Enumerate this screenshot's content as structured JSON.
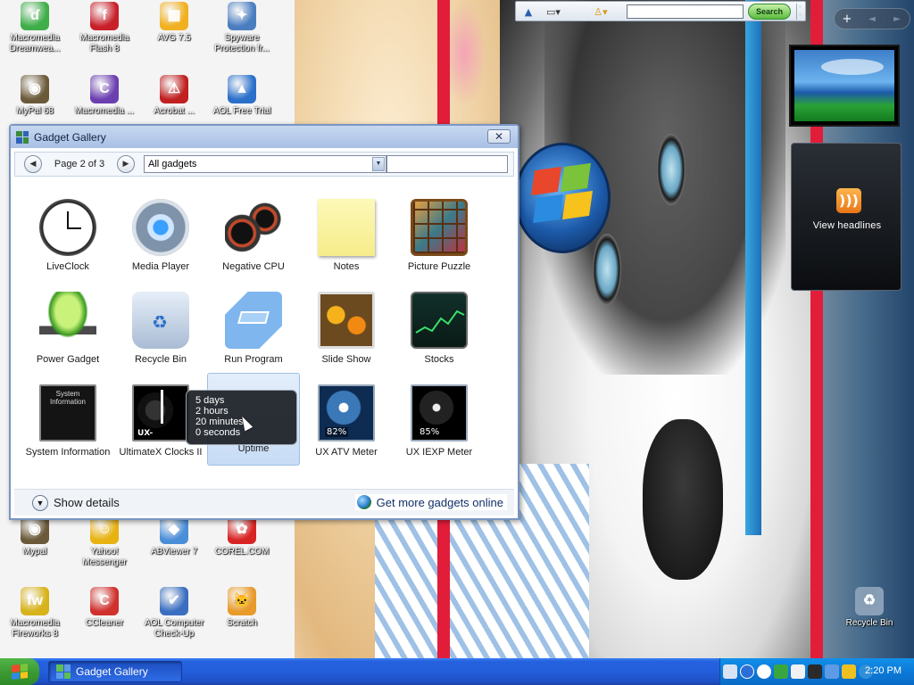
{
  "desktop_icons": [
    {
      "label": "Macromedia Dreamwea...",
      "icon": "dreamweaver-icon",
      "color": "#3fae49",
      "glyph": "ɗ"
    },
    {
      "label": "Macromedia Flash 8",
      "icon": "flash-icon",
      "color": "#c8202a",
      "glyph": "f"
    },
    {
      "label": "AVG 7.5",
      "icon": "avg-icon",
      "color": "#f0b020",
      "glyph": "▦"
    },
    {
      "label": "Spyware Protection fr...",
      "icon": "spyware-protection-icon",
      "color": "#4a7ec0",
      "glyph": "✦"
    },
    {
      "label": "MyPal 68",
      "icon": "mypal-icon",
      "color": "#6b5a3a",
      "glyph": "◉"
    },
    {
      "label": "Macromedia ...",
      "icon": "contribute-icon",
      "color": "#6b3fb0",
      "glyph": "C"
    },
    {
      "label": "Acrobat ...",
      "icon": "acrobat-icon",
      "color": "#c02020",
      "glyph": "⚠"
    },
    {
      "label": "AOL Free Trial",
      "icon": "aol-icon",
      "color": "#2a6fc9",
      "glyph": "▲"
    },
    {
      "label": "Mypal",
      "icon": "mypal2-icon",
      "color": "#6b5a3a",
      "glyph": "◉"
    },
    {
      "label": "Yahoo! Messenger",
      "icon": "yahoo-messenger-icon",
      "color": "#e8b210",
      "glyph": "☺"
    },
    {
      "label": "ABViewer 7",
      "icon": "abviewer-icon",
      "color": "#4a8ed8",
      "glyph": "◆"
    },
    {
      "label": "COREL.COM",
      "icon": "corel-icon",
      "color": "#d82424",
      "glyph": "✿"
    },
    {
      "label": "Macromedia Fireworks 8",
      "icon": "fireworks-icon",
      "color": "#d7b21a",
      "glyph": "fw"
    },
    {
      "label": "CCleaner",
      "icon": "ccleaner-icon",
      "color": "#d0312d",
      "glyph": "C"
    },
    {
      "label": "AOL Computer Check-Up",
      "icon": "aol-checkup-icon",
      "color": "#3a6ec0",
      "glyph": "✔"
    },
    {
      "label": "Scratch",
      "icon": "scratch-icon",
      "color": "#e89a2a",
      "glyph": "🐱"
    },
    {
      "label": "Recycle Bin",
      "icon": "recycle-bin-desktop-icon",
      "color": "#8aa0b8",
      "glyph": "♻"
    }
  ],
  "search_toolbar": {
    "search_placeholder": "",
    "search_button": "Search"
  },
  "sidebar": {
    "controls": {
      "add": "+",
      "prev": "◄",
      "next": "►"
    },
    "rss_label": "View headlines"
  },
  "gallery": {
    "title": "Gadget Gallery",
    "close_glyph": "✕",
    "page_indicator": "Page 2 of 3",
    "category": "All gadgets",
    "gadgets": [
      {
        "name": "LiveClock",
        "icon": "clock-icon"
      },
      {
        "name": "Media Player",
        "icon": "media-player-icon"
      },
      {
        "name": "Negative CPU",
        "icon": "cpu-meter-icon"
      },
      {
        "name": "Notes",
        "icon": "notes-icon"
      },
      {
        "name": "Picture Puzzle",
        "icon": "picture-puzzle-icon"
      },
      {
        "name": "Power Gadget",
        "icon": "battery-plug-icon"
      },
      {
        "name": "Recycle Bin",
        "icon": "recycle-bin-icon"
      },
      {
        "name": "Run Program",
        "icon": "run-program-icon"
      },
      {
        "name": "Slide Show",
        "icon": "slide-show-icon"
      },
      {
        "name": "Stocks",
        "icon": "stocks-icon"
      },
      {
        "name": "System Information",
        "icon": "system-information-icon",
        "inner_text": "System Information"
      },
      {
        "name": "UltimateX Clocks II",
        "icon": "ultimatex-clock-icon",
        "inner_text": "UX-"
      },
      {
        "name": "Uptime",
        "icon": "uptime-icon",
        "selected": true
      },
      {
        "name": "UX ATV Meter",
        "icon": "atv-meter-icon",
        "inner_text": "82%"
      },
      {
        "name": "UX IEXP Meter",
        "icon": "iexp-meter-icon",
        "inner_text": "85%"
      }
    ],
    "show_details": "Show details",
    "get_more": "Get more gadgets online",
    "tooltip": [
      "5 days",
      "2 hours",
      "20 minutes",
      "0 seconds"
    ]
  },
  "taskbar": {
    "task_label": "Gadget Gallery",
    "clock": "2:20 PM"
  },
  "colors": {
    "taskbar_blue": "#245edb",
    "start_green": "#3d9b33",
    "window_border": "#7a96c2"
  }
}
